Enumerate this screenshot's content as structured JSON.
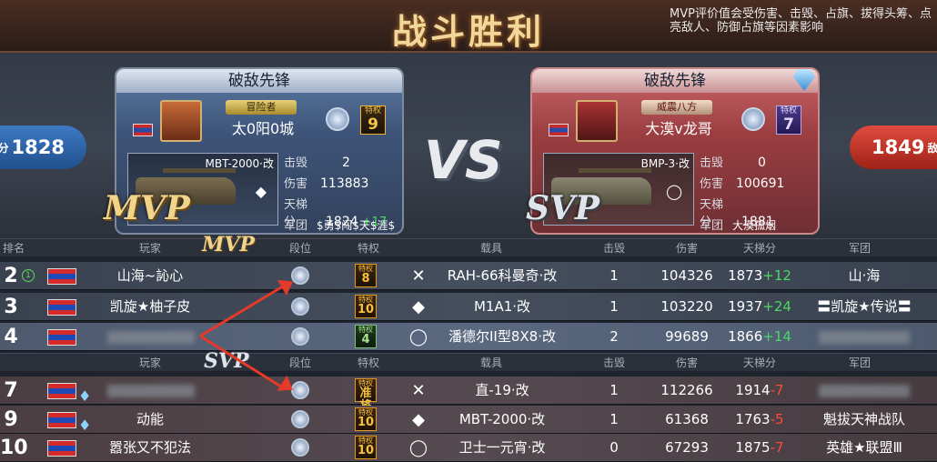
{
  "title": "战斗胜利",
  "note": "MVP评价值会受伤害、击毁、占旗、拔得头筹、点亮敌人、防御占旗等因素影响",
  "left_score": "1828",
  "left_score_tag": "梯分",
  "right_score": "1849",
  "right_score_tag": "敌",
  "vs": "VS",
  "mvp_card": {
    "heading": "破敌先锋",
    "badge": "冒险者",
    "player": "太0阳0城",
    "priv_label": "特权",
    "priv_level": "9",
    "vehicle": "MBT-2000·改",
    "kills_k": "击毁",
    "kills": "2",
    "dmg_k": "伤害",
    "dmg": "113883",
    "ladder_k": "天梯分",
    "ladder": "1824",
    "delta": "+17",
    "clan_k": "军团",
    "clan": "$勇$闯$天$涯$",
    "tag": "MVP"
  },
  "svp_card": {
    "heading": "破敌先锋",
    "badge": "威震八方",
    "player": "大漠v龙哥",
    "priv_label": "特权",
    "priv_level": "7",
    "vehicle": "BMP-3·改",
    "kills_k": "击毁",
    "kills": "0",
    "dmg_k": "伤害",
    "dmg": "100691",
    "ladder_k": "天梯分",
    "ladder": "1881",
    "clan_k": "军团",
    "clan": "大漠孤烟",
    "tag": "SVP"
  },
  "headers": {
    "rank": "排名",
    "player": "玩家",
    "tier": "段位",
    "priv": "特权",
    "vehicle": "载具",
    "kills": "击毁",
    "damage": "伤害",
    "ladder": "天梯分",
    "clan": "军团"
  },
  "section_tags": {
    "mvp": "MVP",
    "svp": "SVP"
  },
  "blue_rows": [
    {
      "rank": "2",
      "mark": "1",
      "name": "山海~訫心",
      "priv_label": "特权",
      "priv": "8",
      "vicon": "✕",
      "vehicle": "RAH-66科曼奇·改",
      "kills": "1",
      "damage": "104326",
      "ladder": "1873",
      "delta": "+12",
      "clan": "山·海"
    },
    {
      "rank": "3",
      "name": "凯旋★柚子皮",
      "priv_label": "特权",
      "priv": "10",
      "vicon": "◆",
      "vehicle": "M1A1·改",
      "kills": "1",
      "damage": "103220",
      "ladder": "1937",
      "delta": "+24",
      "clan": "〓凯旋★传说〓"
    },
    {
      "rank": "4",
      "name": "",
      "priv_label": "特权",
      "priv": "4",
      "vicon": "◯",
      "vehicle": "潘德尔II型8X8·改",
      "kills": "2",
      "damage": "99689",
      "ladder": "1866",
      "delta": "+14",
      "clan": ""
    }
  ],
  "red_rows": [
    {
      "rank": "7",
      "name": "",
      "priv_label": "特权",
      "priv": "准将",
      "vicon": "✕",
      "vehicle": "直-19·改",
      "kills": "1",
      "damage": "112266",
      "ladder": "1914",
      "delta": "-7",
      "clan": ""
    },
    {
      "rank": "9",
      "name": "动能",
      "priv_label": "特权",
      "priv": "10",
      "vicon": "◆",
      "vehicle": "MBT-2000·改",
      "kills": "1",
      "damage": "61368",
      "ladder": "1763",
      "delta": "-5",
      "clan": "魁拔天神战队"
    },
    {
      "rank": "10",
      "name": "嚣张又不犯法",
      "priv_label": "特权",
      "priv": "10",
      "vicon": "◯",
      "vehicle": "卫士一元宵·改",
      "kills": "0",
      "damage": "67293",
      "ladder": "1875",
      "delta": "-7",
      "clan": "英雄★联盟Ⅲ"
    }
  ]
}
